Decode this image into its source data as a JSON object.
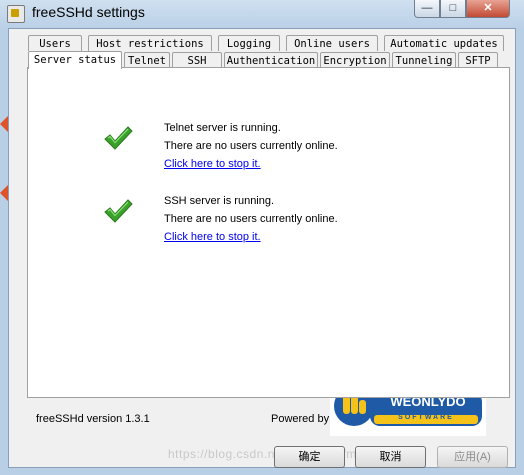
{
  "window": {
    "title": "freeSSHd settings",
    "minimize_glyph": "—",
    "maximize_glyph": "□",
    "close_glyph": "✕"
  },
  "tabs_row1": [
    "Users",
    "Host restrictions",
    "Logging",
    "Online users",
    "Automatic updates"
  ],
  "tabs_row2": [
    "Server status",
    "Telnet",
    "SSH",
    "Authentication",
    "Encryption",
    "Tunneling",
    "SFTP"
  ],
  "active_tab": "Server status",
  "telnet": {
    "status": "Telnet server is running.",
    "users": "There are no users currently online.",
    "action": "Click here to stop it."
  },
  "ssh": {
    "status": "SSH server is running.",
    "users": "There are no users currently online.",
    "action": "Click here to stop it."
  },
  "footer": {
    "version": "freeSSHd version 1.3.1",
    "powered_by": "Powered by"
  },
  "logo": {
    "brand": "WEONLYDO",
    "sub": "SOFTWARE"
  },
  "buttons": {
    "ok": "确定",
    "cancel": "取消",
    "apply": "应用(A)"
  },
  "watermark": "https://blog.csdn.net/ryfmyfmyfmyf",
  "icons": {
    "status_ok": "check-icon"
  },
  "colors": {
    "link": "#0000ee",
    "check": "#3aa12b"
  }
}
